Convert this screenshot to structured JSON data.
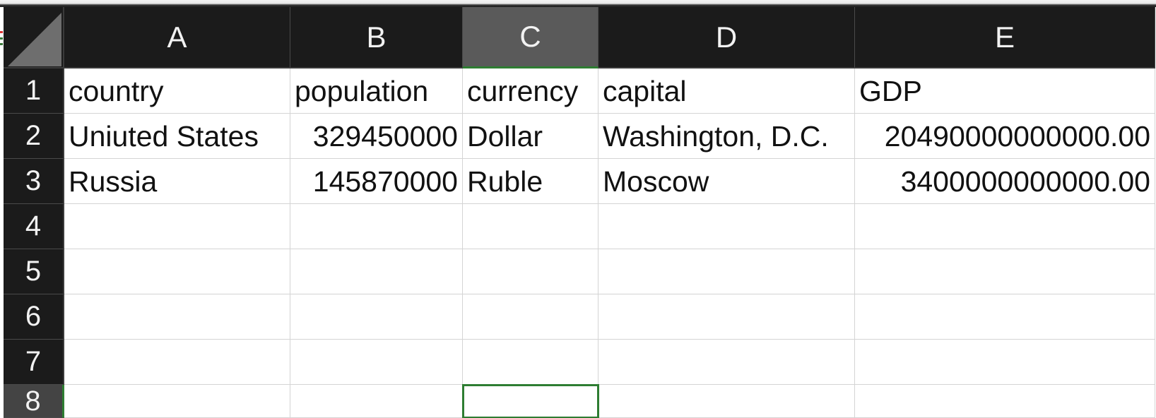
{
  "sheet": {
    "columns": [
      "A",
      "B",
      "C",
      "D",
      "E"
    ],
    "selected_column": "C",
    "rows": [
      "1",
      "2",
      "3",
      "4",
      "5",
      "6",
      "7",
      "8"
    ],
    "active_cell": "C8",
    "cells": [
      [
        "country",
        "population",
        "currency",
        "capital",
        "GDP"
      ],
      [
        "Uniuted States",
        "329450000",
        "Dollar",
        "Washington, D.C.",
        "20490000000000.00"
      ],
      [
        "Russia",
        "145870000",
        "Ruble",
        "Moscow",
        "3400000000000.00"
      ],
      [
        "",
        "",
        "",
        "",
        ""
      ],
      [
        "",
        "",
        "",
        "",
        ""
      ],
      [
        "",
        "",
        "",
        "",
        ""
      ],
      [
        "",
        "",
        "",
        "",
        ""
      ],
      [
        "",
        "",
        "",
        "",
        ""
      ]
    ]
  }
}
